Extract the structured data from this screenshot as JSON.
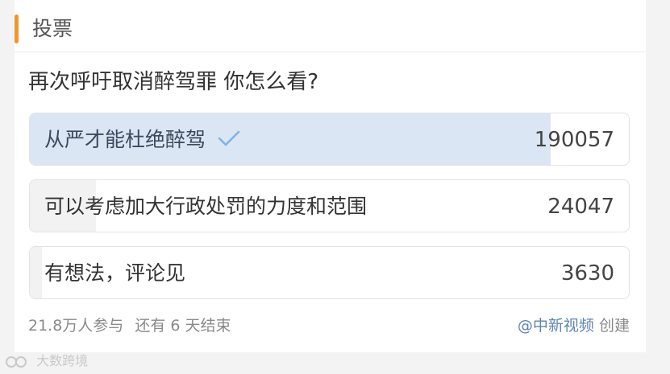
{
  "header": {
    "title": "投票"
  },
  "poll": {
    "question": "再次呼吁取消醉驾罪 你怎么看?",
    "options": [
      {
        "label": "从严才能杜绝醉驾",
        "count": "190057",
        "fill": 0.87,
        "selected": true
      },
      {
        "label": "可以考虑加大行政处罚的力度和范围",
        "count": "24047",
        "fill": 0.11,
        "selected": false
      },
      {
        "label": "有想法，评论见",
        "count": "3630",
        "fill": 0.02,
        "selected": false
      }
    ],
    "participants": "21.8万人参与",
    "remaining": "还有 6 天结束",
    "creator_name": "@中新视频",
    "creator_suffix": "创建"
  },
  "watermark": {
    "text": "大数跨境"
  },
  "colors": {
    "accent": "#f0962e",
    "selected_fill": "#dbe6f5",
    "unselected_fill": "#f2f2f2",
    "check": "#7fb2e6",
    "link": "#5f84b8"
  },
  "icons": {
    "check": "check-icon",
    "logo": "watermark-logo-icon"
  }
}
